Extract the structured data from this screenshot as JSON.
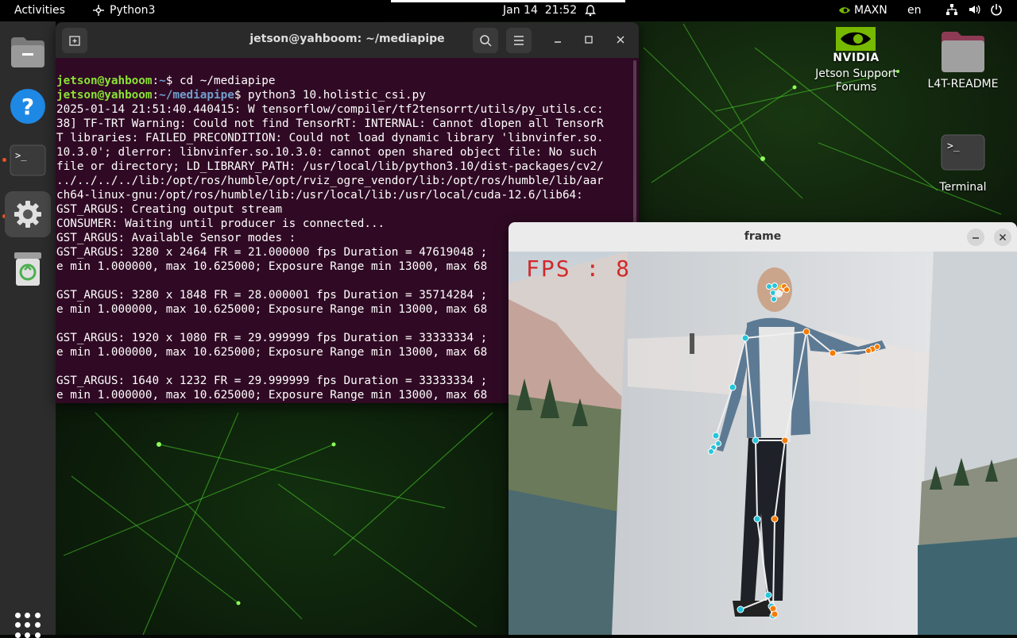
{
  "topbar": {
    "activities": "Activities",
    "app_name": "Python3",
    "date": "Jan 14",
    "time": "21:52",
    "power_mode": "MAXN",
    "language": "en"
  },
  "dock": {
    "items": [
      "files",
      "help",
      "terminal",
      "settings",
      "trash",
      "show-applications"
    ]
  },
  "desktop": {
    "icons": [
      {
        "label": "Jetson Support Forums",
        "icon": "nvidia-icon"
      },
      {
        "label": "L4T-README",
        "icon": "folder-icon"
      },
      {
        "label": "Terminal",
        "icon": "terminal-icon"
      }
    ],
    "nvidia_text": "NVIDIA"
  },
  "terminal": {
    "title": "jetson@yahboom: ~/mediapipe",
    "prompt_user": "jetson@yahboom",
    "line1_path": "~",
    "line1_cmd": "$ cd ~/mediapipe",
    "line2_path": "~/mediapipe",
    "line2_cmd": "$ python3 10.holistic_csi.py",
    "output": [
      "2025-01-14 21:51:40.440415: W tensorflow/compiler/tf2tensorrt/utils/py_utils.cc:",
      "38] TF-TRT Warning: Could not find TensorRT: INTERNAL: Cannot dlopen all TensorR",
      "T libraries: FAILED_PRECONDITION: Could not load dynamic library 'libnvinfer.so.",
      "10.3.0'; dlerror: libnvinfer.so.10.3.0: cannot open shared object file: No such",
      "file or directory; LD_LIBRARY_PATH: /usr/local/lib/python3.10/dist-packages/cv2/",
      "../../../../lib:/opt/ros/humble/opt/rviz_ogre_vendor/lib:/opt/ros/humble/lib/aar",
      "ch64-linux-gnu:/opt/ros/humble/lib:/usr/local/lib:/usr/local/cuda-12.6/lib64:",
      "GST_ARGUS: Creating output stream",
      "CONSUMER: Waiting until producer is connected...",
      "GST_ARGUS: Available Sensor modes :",
      "GST_ARGUS: 3280 x 2464 FR = 21.000000 fps Duration = 47619048 ;",
      "e min 1.000000, max 10.625000; Exposure Range min 13000, max 68",
      "",
      "GST_ARGUS: 3280 x 1848 FR = 28.000001 fps Duration = 35714284 ;",
      "e min 1.000000, max 10.625000; Exposure Range min 13000, max 68",
      "",
      "GST_ARGUS: 1920 x 1080 FR = 29.999999 fps Duration = 33333334 ;",
      "e min 1.000000, max 10.625000; Exposure Range min 13000, max 68",
      "",
      "GST_ARGUS: 1640 x 1232 FR = 29.999999 fps Duration = 33333334 ;",
      "e min 1.000000, max 10.625000; Exposure Range min 13000, max 68"
    ]
  },
  "frame_window": {
    "title": "frame",
    "fps_label": "FPS : 8"
  },
  "colors": {
    "terminal_bg": "#300a24",
    "prompt_green": "#8ae234",
    "prompt_blue": "#729fcf",
    "accent": "#e95420",
    "pose_left": "#26c6da",
    "pose_right": "#f57c00"
  }
}
